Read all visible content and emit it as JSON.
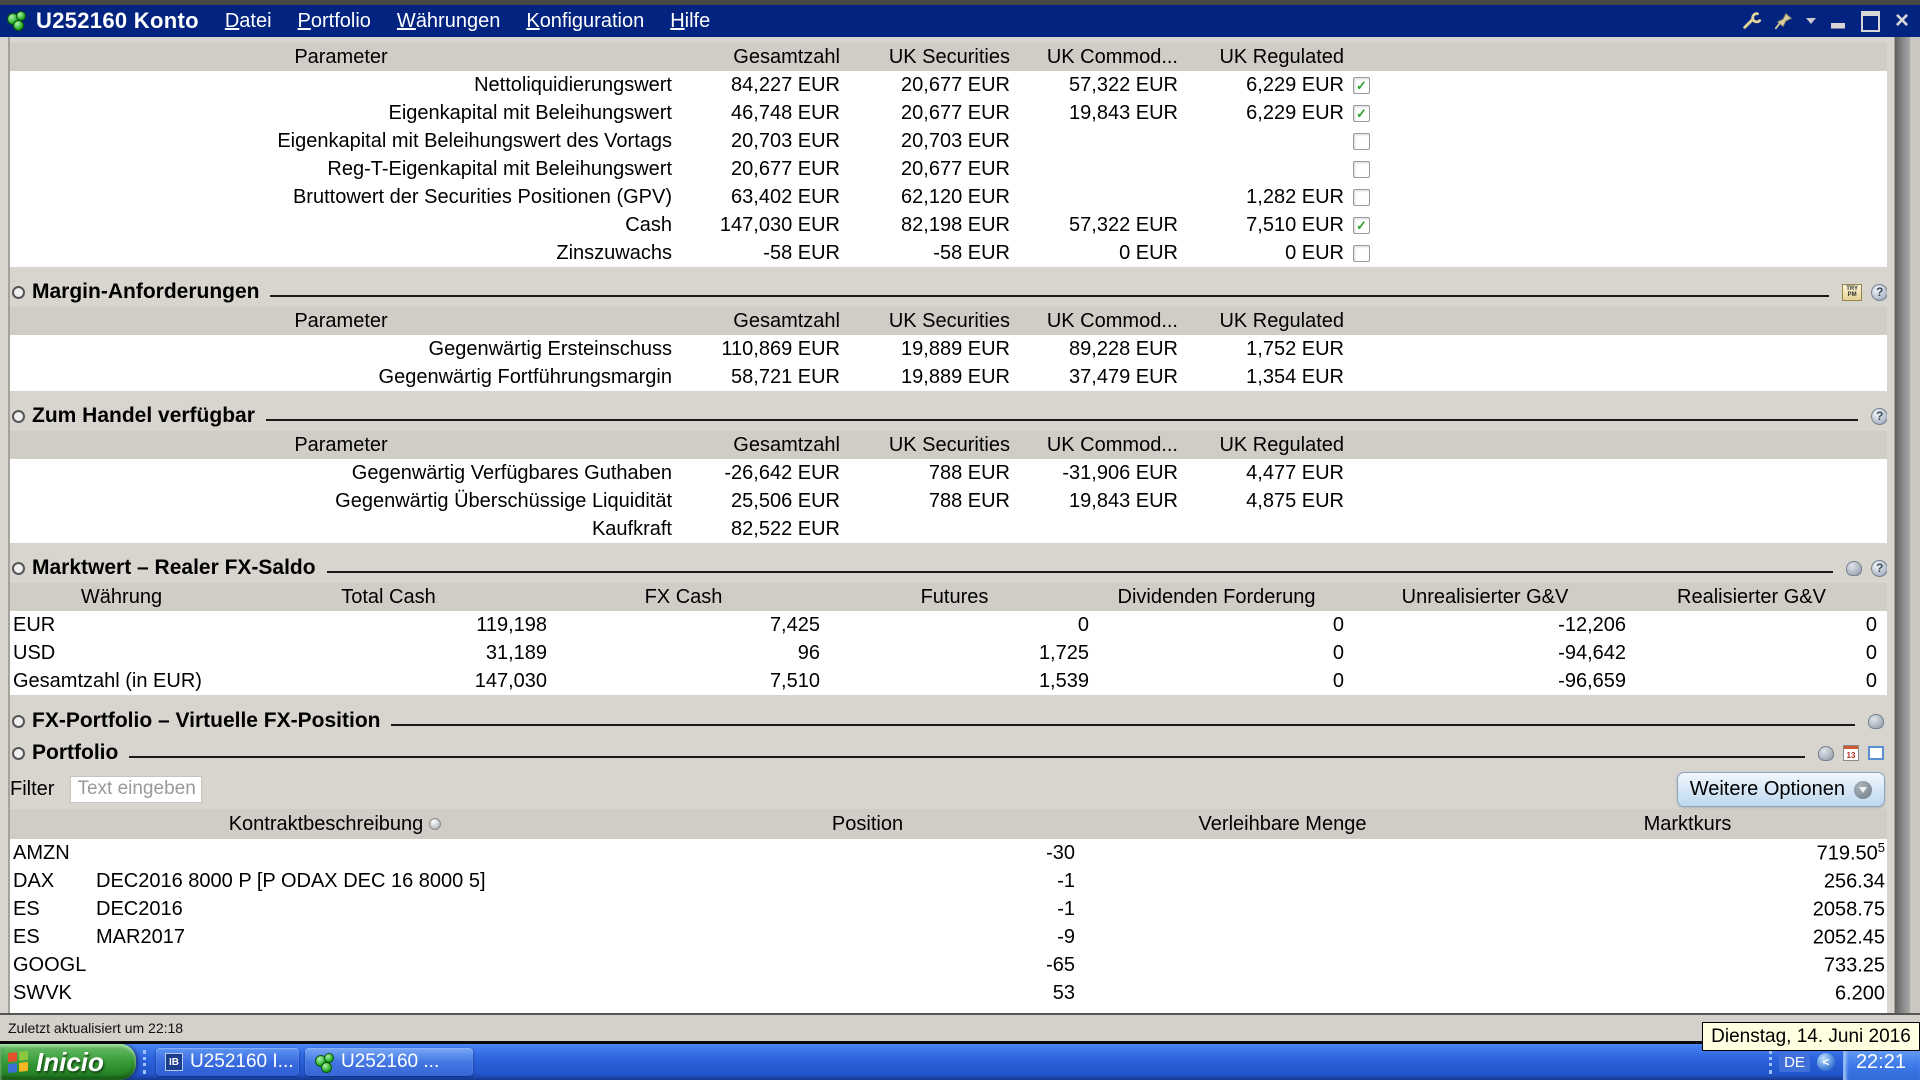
{
  "window": {
    "title": "U252160 Konto",
    "menus": [
      "Datei",
      "Portfolio",
      "Währungen",
      "Konfiguration",
      "Hilfe"
    ]
  },
  "colors": {
    "titlebar": "#032380",
    "taskbar_blue": "#2c63dc",
    "section_bg": "#d8d5ce",
    "header_row": "#d0cdc6",
    "check_green": "#2ea22e",
    "tooltip_bg": "#ffffe1",
    "button_face": "#d9e9f7"
  },
  "icons": {
    "help": "?",
    "close": "×",
    "plus": "+",
    "trypm_line1": "TRY",
    "trypm_line2": "PM",
    "calendar_day": "13",
    "ib": "IB",
    "tray_arrow": "<"
  },
  "param_headers": [
    "Parameter",
    "Gesamtzahl",
    "UK Securities",
    "UK Commod...",
    "UK Regulated"
  ],
  "account": {
    "rows": [
      {
        "label": "Nettoliquidierungswert",
        "total": "84,227 EUR",
        "uk_sec": "20,677 EUR",
        "uk_com": "57,322 EUR",
        "uk_reg": "6,229 EUR",
        "checked": true
      },
      {
        "label": "Eigenkapital mit Beleihungswert",
        "total": "46,748 EUR",
        "uk_sec": "20,677 EUR",
        "uk_com": "19,843 EUR",
        "uk_reg": "6,229 EUR",
        "checked": true
      },
      {
        "label": "Eigenkapital mit Beleihungswert des Vortags",
        "total": "20,703 EUR",
        "uk_sec": "20,703 EUR",
        "uk_com": "",
        "uk_reg": "",
        "checked": false
      },
      {
        "label": "Reg-T-Eigenkapital mit Beleihungswert",
        "total": "20,677 EUR",
        "uk_sec": "20,677 EUR",
        "uk_com": "",
        "uk_reg": "",
        "checked": false
      },
      {
        "label": "Bruttowert der Securities Positionen (GPV)",
        "total": "63,402 EUR",
        "uk_sec": "62,120 EUR",
        "uk_com": "",
        "uk_reg": "1,282 EUR",
        "checked": false
      },
      {
        "label": "Cash",
        "total": "147,030 EUR",
        "uk_sec": "82,198 EUR",
        "uk_com": "57,322 EUR",
        "uk_reg": "7,510 EUR",
        "checked": true
      },
      {
        "label": "Zinszuwachs",
        "total": "-58 EUR",
        "uk_sec": "-58 EUR",
        "uk_com": "0 EUR",
        "uk_reg": "0 EUR",
        "checked": false
      }
    ]
  },
  "margin": {
    "title": "Margin-Anforderungen",
    "rows": [
      {
        "label": "Gegenwärtig Ersteinschuss",
        "total": "110,869 EUR",
        "uk_sec": "19,889 EUR",
        "uk_com": "89,228 EUR",
        "uk_reg": "1,752 EUR"
      },
      {
        "label": "Gegenwärtig Fortführungsmargin",
        "total": "58,721 EUR",
        "uk_sec": "19,889 EUR",
        "uk_com": "37,479 EUR",
        "uk_reg": "1,354 EUR"
      }
    ]
  },
  "available": {
    "title": "Zum Handel verfügbar",
    "rows": [
      {
        "label": "Gegenwärtig Verfügbares Guthaben",
        "total": "-26,642 EUR",
        "uk_sec": "788 EUR",
        "uk_com": "-31,906 EUR",
        "uk_reg": "4,477 EUR"
      },
      {
        "label": "Gegenwärtig Überschüssige Liquidität",
        "total": "25,506 EUR",
        "uk_sec": "788 EUR",
        "uk_com": "19,843 EUR",
        "uk_reg": "4,875 EUR"
      },
      {
        "label": "Kaufkraft",
        "total": "82,522 EUR",
        "uk_sec": "",
        "uk_com": "",
        "uk_reg": ""
      }
    ]
  },
  "fx": {
    "title": "Marktwert – Realer FX-Saldo",
    "headers": [
      "Währung",
      "Total Cash",
      "FX Cash",
      "Futures",
      "Dividenden Forderung",
      "Unrealisierter G&V",
      "Realisierter G&V"
    ],
    "rows": [
      {
        "cur": "EUR",
        "total": "119,198",
        "fxcash": "7,425",
        "fut": "0",
        "div": "0",
        "unreal": "-12,206",
        "real": "0"
      },
      {
        "cur": "USD",
        "total": "31,189",
        "fxcash": "96",
        "fut": "1,725",
        "div": "0",
        "unreal": "-94,642",
        "real": "0"
      },
      {
        "cur": "Gesamtzahl (in EUR)",
        "total": "147,030",
        "fxcash": "7,510",
        "fut": "1,539",
        "div": "0",
        "unreal": "-96,659",
        "real": "0"
      }
    ]
  },
  "fx_portfolio": {
    "title": "FX-Portfolio – Virtuelle FX-Position"
  },
  "portfolio": {
    "title": "Portfolio",
    "filter_label": "Filter",
    "filter_placeholder": "Text eingeben",
    "more_options": "Weitere Optionen",
    "headers": [
      "Kontraktbeschreibung",
      "Position",
      "Verleihbare Menge",
      "Marktkurs"
    ],
    "rows": [
      {
        "symbol": "AMZN",
        "desc": "",
        "position": "-30",
        "lendable": "",
        "price": "719.50",
        "price_sup": "5"
      },
      {
        "symbol": "DAX",
        "desc": "DEC2016 8000 P [P ODAX DEC 16  8000 5]",
        "position": "-1",
        "lendable": "",
        "price": "256.34",
        "price_sup": ""
      },
      {
        "symbol": "ES",
        "desc": "DEC2016",
        "position": "-1",
        "lendable": "",
        "price": "2058.75",
        "price_sup": ""
      },
      {
        "symbol": "ES",
        "desc": "MAR2017",
        "position": "-9",
        "lendable": "",
        "price": "2052.45",
        "price_sup": ""
      },
      {
        "symbol": "GOOGL",
        "desc": "",
        "position": "-65",
        "lendable": "",
        "price": "733.25",
        "price_sup": ""
      },
      {
        "symbol": "SWVK",
        "desc": "",
        "position": "53",
        "lendable": "",
        "price": "6.200",
        "price_sup": ""
      }
    ]
  },
  "statusbar": {
    "last_update": "Zuletzt aktualisiert um 22:18"
  },
  "tooltip": {
    "date": "Dienstag, 14. Juni 2016"
  },
  "taskbar": {
    "start": "Inicio",
    "buttons": [
      "U252160 I...",
      "U252160 ..."
    ],
    "lang": "DE",
    "clock": "22:21"
  }
}
